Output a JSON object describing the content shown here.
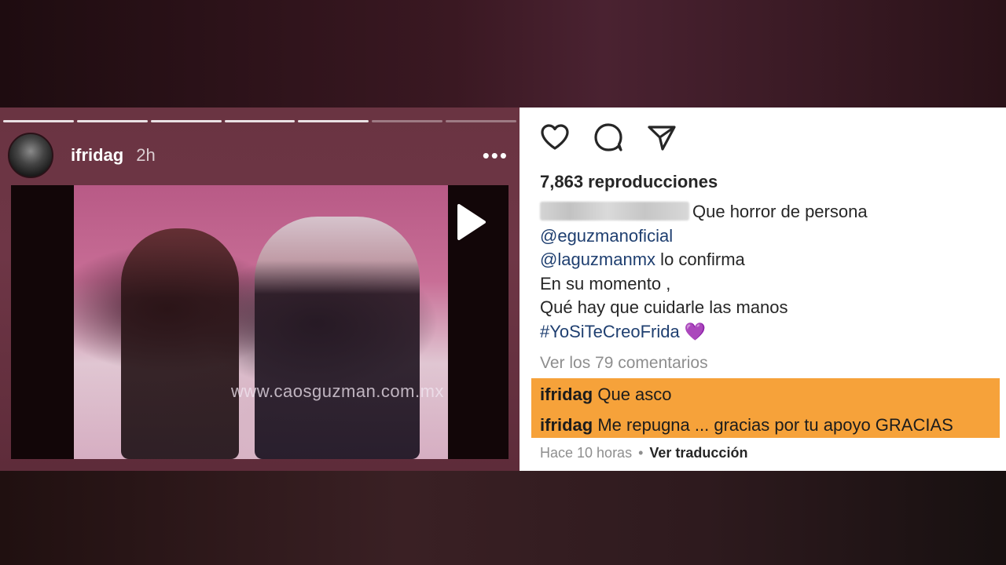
{
  "story": {
    "username": "ifridag",
    "time": "2h",
    "more": "•••",
    "video_watermark": "www.caosguzman.com.mx",
    "progress_segments": 7
  },
  "post": {
    "views": "7,863 reproducciones",
    "caption_text": "Que horror de persona",
    "mention1": "@eguzmanoficial",
    "mention2": "@laguzmanmx",
    "mention2_suffix": " lo confirma",
    "line_en_su_momento": "En su momento ,",
    "line_cuidar": "Qué hay que cuidarle las manos",
    "hashtag": "#YoSiTeCreoFrida",
    "hashtag_emoji": "💜",
    "view_comments": "Ver los 79 comentarios",
    "comments": [
      {
        "user": "ifridag",
        "text": "Que asco"
      },
      {
        "user": "ifridag",
        "text": "Me repugna ... gracias por tu apoyo GRACIAS"
      }
    ],
    "timestamp": "Hace 10 horas",
    "separator": "•",
    "translate": "Ver traducción"
  },
  "icons": [
    "heart-icon",
    "comment-icon",
    "share-icon",
    "play-icon",
    "more-icon"
  ],
  "colors": {
    "highlight": "#f6a23a",
    "mention": "#1f3f70",
    "story_bg": "#6a3442"
  }
}
